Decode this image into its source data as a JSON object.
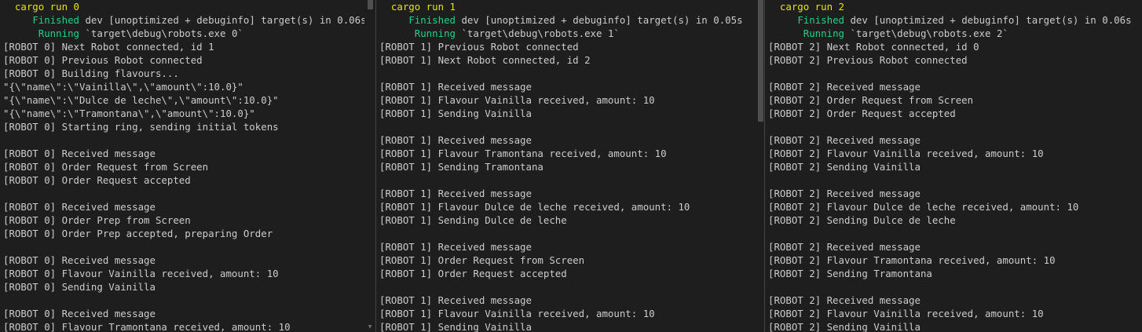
{
  "terminals": [
    {
      "command": "cargo run 0",
      "finished_label": "Finished",
      "finished_text": " dev [unoptimized + debuginfo] target(s) in 0.06s",
      "running_label": "Running",
      "running_text": " `target\\debug\\robots.exe 0`",
      "output": [
        "[ROBOT 0] Next Robot connected, id 1",
        "[ROBOT 0] Previous Robot connected",
        "[ROBOT 0] Building flavours...",
        "\"{\\\"name\\\":\\\"Vainilla\\\",\\\"amount\\\":10.0}\"",
        "\"{\\\"name\\\":\\\"Dulce de leche\\\",\\\"amount\\\":10.0}\"",
        "\"{\\\"name\\\":\\\"Tramontana\\\",\\\"amount\\\":10.0}\"",
        "[ROBOT 0] Starting ring, sending initial tokens",
        "",
        "[ROBOT 0] Received message",
        "[ROBOT 0] Order Request from Screen",
        "[ROBOT 0] Order Request accepted",
        "",
        "[ROBOT 0] Received message",
        "[ROBOT 0] Order Prep from Screen",
        "[ROBOT 0] Order Prep accepted, preparing Order",
        "",
        "[ROBOT 0] Received message",
        "[ROBOT 0] Flavour Vainilla received, amount: 10",
        "[ROBOT 0] Sending Vainilla",
        "",
        "[ROBOT 0] Received message",
        "[ROBOT 0] Flavour Tramontana received, amount: 10"
      ]
    },
    {
      "command": "cargo run 1",
      "finished_label": "Finished",
      "finished_text": " dev [unoptimized + debuginfo] target(s) in 0.05s",
      "running_label": "Running",
      "running_text": " `target\\debug\\robots.exe 1`",
      "output": [
        "[ROBOT 1] Previous Robot connected",
        "[ROBOT 1] Next Robot connected, id 2",
        "",
        "[ROBOT 1] Received message",
        "[ROBOT 1] Flavour Vainilla received, amount: 10",
        "[ROBOT 1] Sending Vainilla",
        "",
        "[ROBOT 1] Received message",
        "[ROBOT 1] Flavour Tramontana received, amount: 10",
        "[ROBOT 1] Sending Tramontana",
        "",
        "[ROBOT 1] Received message",
        "[ROBOT 1] Flavour Dulce de leche received, amount: 10",
        "[ROBOT 1] Sending Dulce de leche",
        "",
        "[ROBOT 1] Received message",
        "[ROBOT 1] Order Request from Screen",
        "[ROBOT 1] Order Request accepted",
        "",
        "[ROBOT 1] Received message",
        "[ROBOT 1] Flavour Vainilla received, amount: 10",
        "[ROBOT 1] Sending Vainilla"
      ]
    },
    {
      "command": "cargo run 2",
      "finished_label": "Finished",
      "finished_text": " dev [unoptimized + debuginfo] target(s) in 0.06s",
      "running_label": "Running",
      "running_text": " `target\\debug\\robots.exe 2`",
      "output": [
        "[ROBOT 2] Next Robot connected, id 0",
        "[ROBOT 2] Previous Robot connected",
        "",
        "[ROBOT 2] Received message",
        "[ROBOT 2] Order Request from Screen",
        "[ROBOT 2] Order Request accepted",
        "",
        "[ROBOT 2] Received message",
        "[ROBOT 2] Flavour Vainilla received, amount: 10",
        "[ROBOT 2] Sending Vainilla",
        "",
        "[ROBOT 2] Received message",
        "[ROBOT 2] Flavour Dulce de leche received, amount: 10",
        "[ROBOT 2] Sending Dulce de leche",
        "",
        "[ROBOT 2] Received message",
        "[ROBOT 2] Flavour Tramontana received, amount: 10",
        "[ROBOT 2] Sending Tramontana",
        "",
        "[ROBOT 2] Received message",
        "[ROBOT 2] Flavour Vainilla received, amount: 10",
        "[ROBOT 2] Sending Vainilla"
      ]
    }
  ],
  "icons": {
    "scroll_up": "chevron-up-icon",
    "scroll_down": "chevron-down-icon"
  },
  "colors": {
    "background": "#1e1e1e",
    "text": "#cccccc",
    "command": "#e5e510",
    "status_green": "#23d18b"
  }
}
